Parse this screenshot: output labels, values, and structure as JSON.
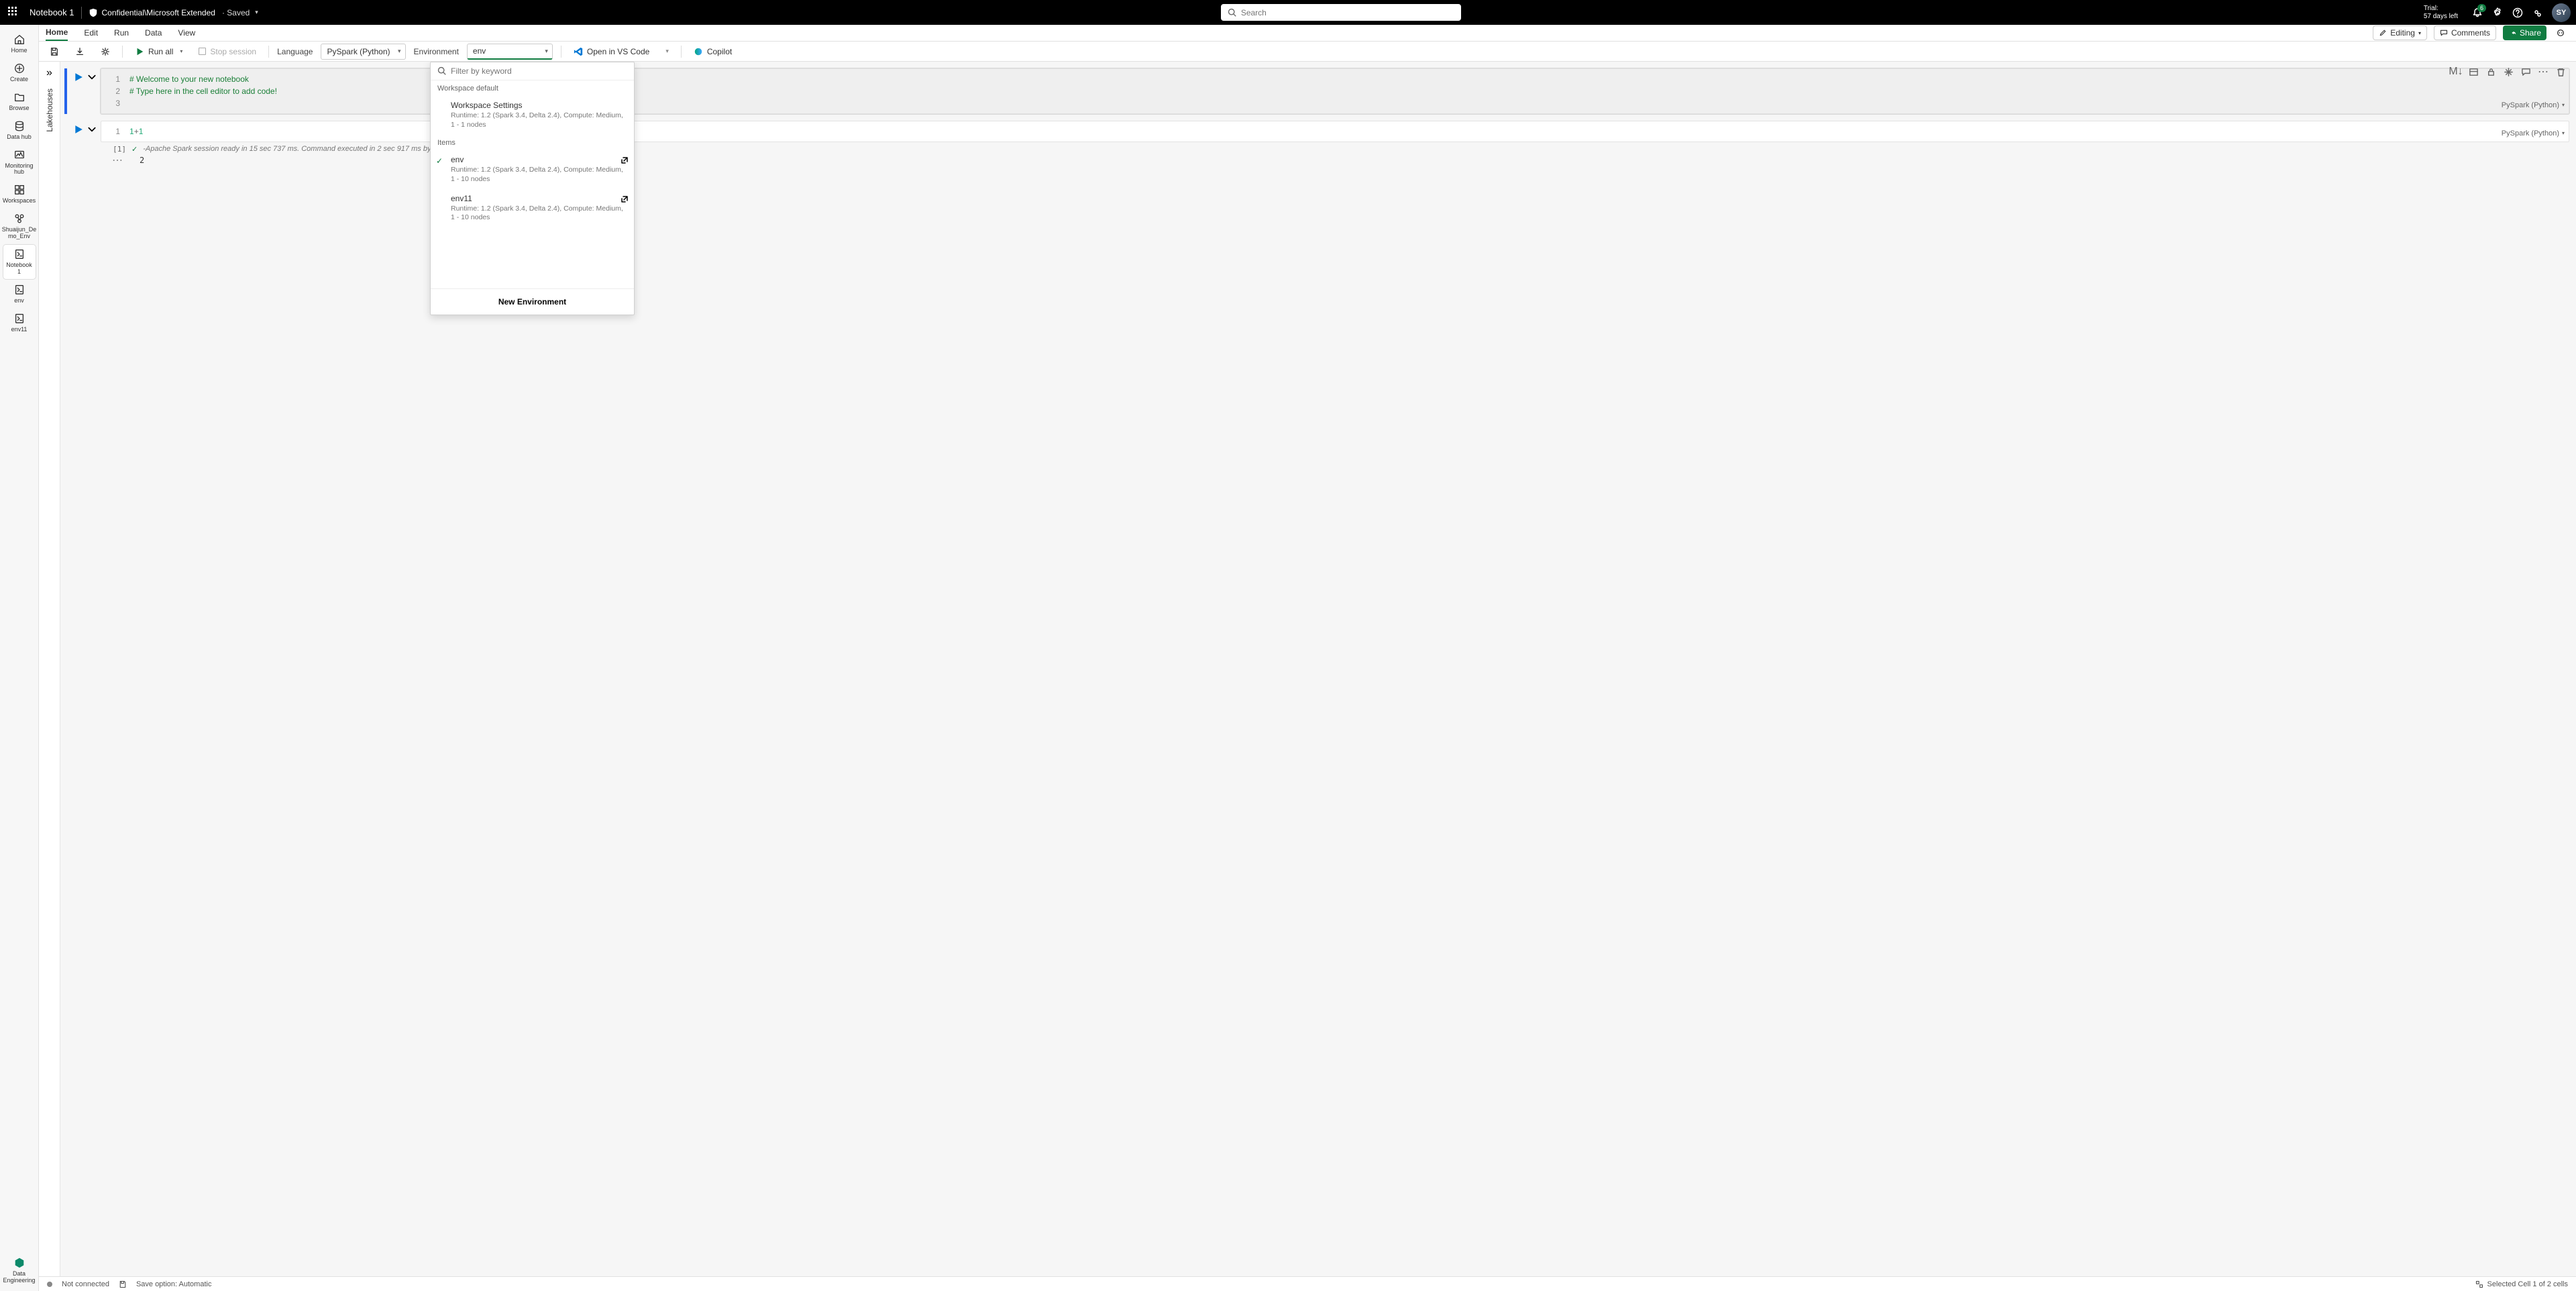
{
  "header": {
    "notebook_title": "Notebook 1",
    "sensitivity": "Confidential\\Microsoft Extended",
    "save_status": "·  Saved",
    "search_placeholder": "Search",
    "trial_line1": "Trial:",
    "trial_line2": "57 days left",
    "notification_count": "6"
  },
  "tabs": {
    "items": [
      "Home",
      "Edit",
      "Run",
      "Data",
      "View"
    ],
    "active": "Home",
    "editing_label": "Editing",
    "comments_label": "Comments",
    "share_label": "Share"
  },
  "toolbar": {
    "run_all_label": "Run all",
    "stop_session_label": "Stop session",
    "language_label": "Language",
    "language_value": "PySpark (Python)",
    "environment_label": "Environment",
    "environment_value": "env",
    "open_vscode_label": "Open in VS Code",
    "copilot_label": "Copilot"
  },
  "rail": {
    "items": [
      {
        "label": "Home"
      },
      {
        "label": "Create"
      },
      {
        "label": "Browse"
      },
      {
        "label": "Data hub"
      },
      {
        "label": "Monitoring hub"
      },
      {
        "label": "Workspaces"
      },
      {
        "label": "Shuaijun_De\nmo_Env"
      },
      {
        "label": "Notebook 1",
        "active": true
      },
      {
        "label": "env"
      },
      {
        "label": "env11"
      }
    ],
    "footer": "Data Engineering"
  },
  "lakehouses_label": "Lakehouses",
  "cells": [
    {
      "lines": [
        {
          "n": "1",
          "text": "# Welcome to your new notebook",
          "cls": "comment"
        },
        {
          "n": "2",
          "text": "# Type here in the cell editor to add code!",
          "cls": "comment"
        },
        {
          "n": "3",
          "text": "",
          "cls": ""
        }
      ],
      "lang": "PySpark (Python)",
      "selected": true
    },
    {
      "lines": [
        {
          "n": "1",
          "text_html": "<span>1</span><span style='color:#555'>+</span><span class='num'>1</span>"
        }
      ],
      "lang": "PySpark (Python)",
      "out_idx": "[1]",
      "out_status": "-Apache Spark session ready in 15 sec 737 ms. Command executed in 2 sec 917 ms by Shuaijun Ye on 4:59:0…",
      "out_val": "2"
    }
  ],
  "env_dropdown": {
    "filter_placeholder": "Filter by keyword",
    "workspace_default_label": "Workspace default",
    "workspace_settings": {
      "name": "Workspace Settings",
      "meta": "Runtime: 1.2 (Spark 3.4, Delta 2.4), Compute: Medium, 1 - 1 nodes"
    },
    "items_label": "Items",
    "items": [
      {
        "name": "env",
        "meta": "Runtime: 1.2 (Spark 3.4, Delta 2.4), Compute: Medium, 1 - 10 nodes",
        "checked": true
      },
      {
        "name": "env11",
        "meta": "Runtime: 1.2 (Spark 3.4, Delta 2.4), Compute: Medium, 1 - 10 nodes"
      }
    ],
    "new_label": "New Environment"
  },
  "status": {
    "connection": "Not connected",
    "save_option": "Save option: Automatic",
    "selection": "Selected Cell 1 of 2 cells"
  }
}
